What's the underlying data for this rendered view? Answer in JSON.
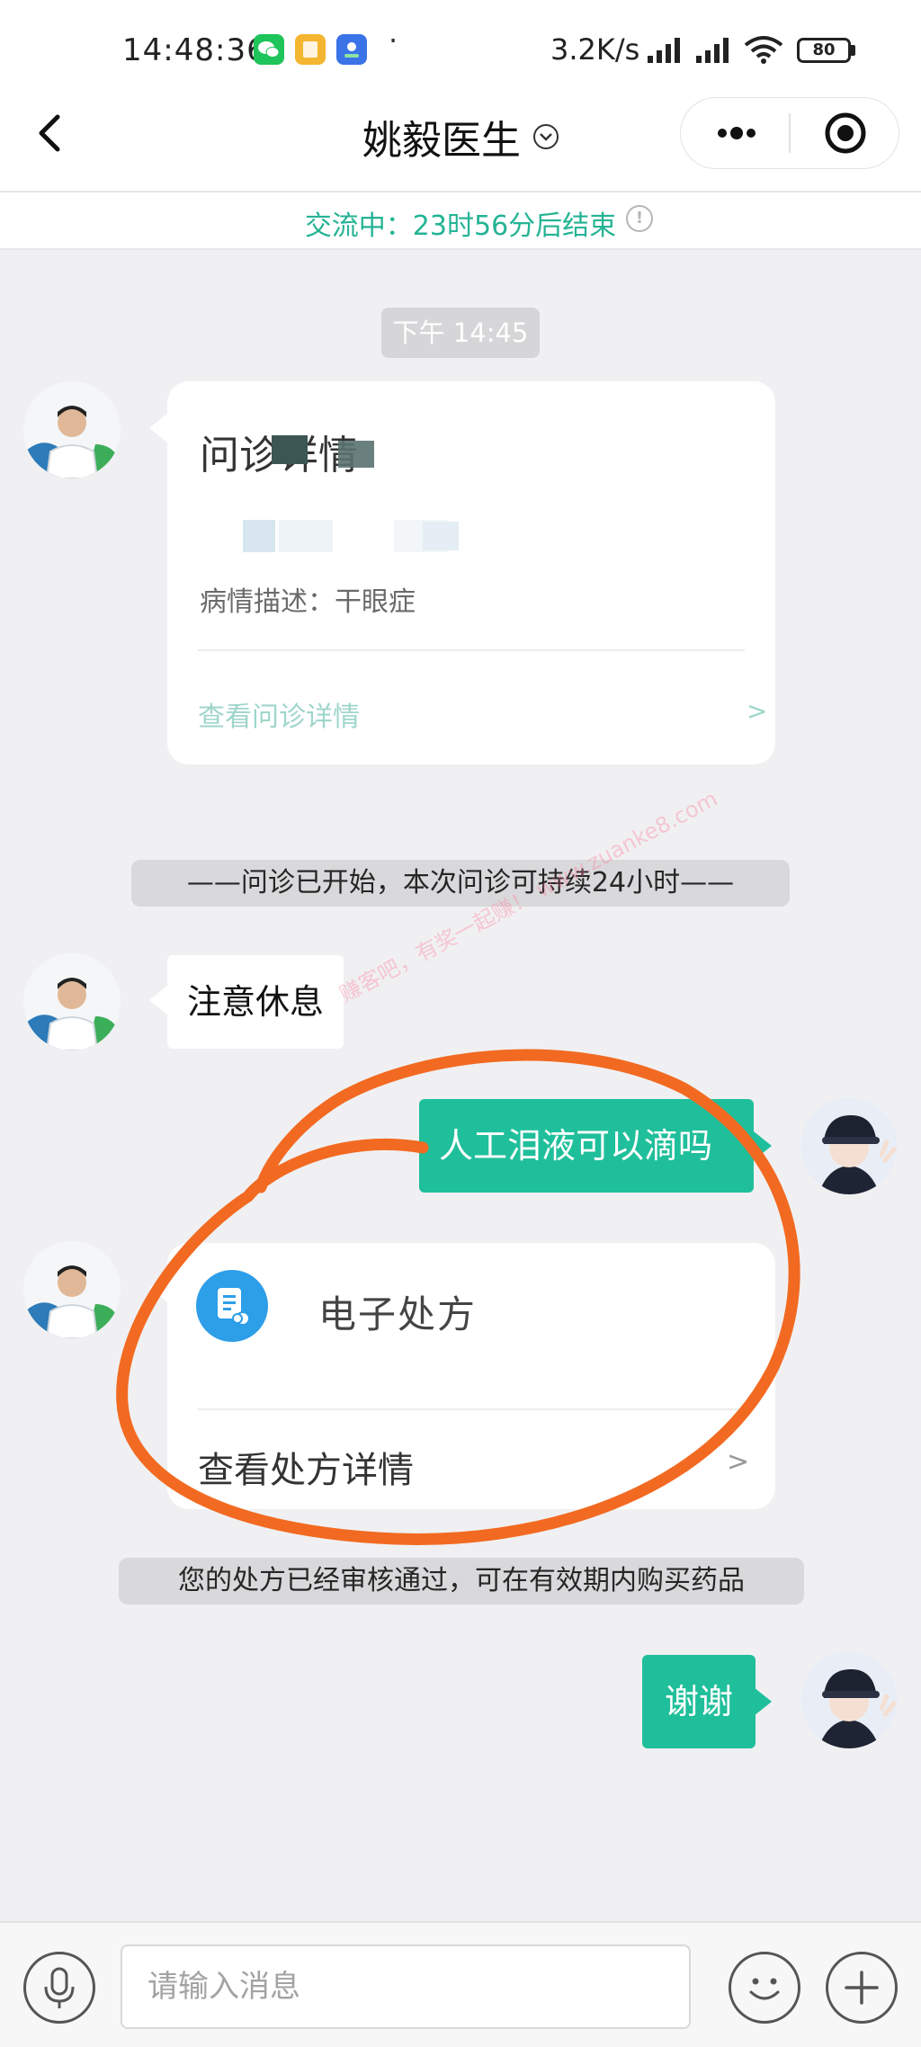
{
  "status_bar": {
    "time": "14:48:36",
    "notifications": [
      {
        "icon": "wechat-icon",
        "color": "#1fc45a"
      },
      {
        "icon": "app-notification-icon",
        "color": "#f4b530"
      },
      {
        "icon": "app-notification-icon",
        "color": "#3a73e8"
      }
    ],
    "dot": "·",
    "net_speed": "3.2K/s",
    "battery": "80"
  },
  "header": {
    "title": "姚毅医生",
    "back_icon": "back-arrow-icon",
    "more_icon": "more-dots-icon",
    "close_icon": "target-circle-icon"
  },
  "banner": {
    "text": "交流中：23时56分后结束",
    "icon": "info-icon",
    "accent": "#24b394"
  },
  "chat": {
    "timestamp": "下午 14:45",
    "consult_card": {
      "title": "问诊详情",
      "desc": "病情描述：干眼症",
      "link": "查看问诊详情",
      "chevron": ">"
    },
    "notice_start": "——问诊已开始，本次问诊可持续24小时——",
    "doctor_msg": "注意休息",
    "my_msg_1": "人工泪液可以滴吗",
    "rx_card": {
      "title": "电子处方",
      "link": "查看处方详情",
      "chevron": ">",
      "icon": "prescription-icon"
    },
    "notice_rx": "您的处方已经审核通过，可在有效期内购买药品",
    "my_msg_2": "谢谢",
    "bubble_color": "#20bf9b",
    "watermark": "赚客吧，有奖一起赚！ www.zuanke8.com"
  },
  "input_bar": {
    "placeholder": "请输入消息",
    "mic_icon": "microphone-icon",
    "emoji_icon": "smiley-icon",
    "plus_icon": "plus-icon"
  },
  "annotation_color": "#f26a21"
}
